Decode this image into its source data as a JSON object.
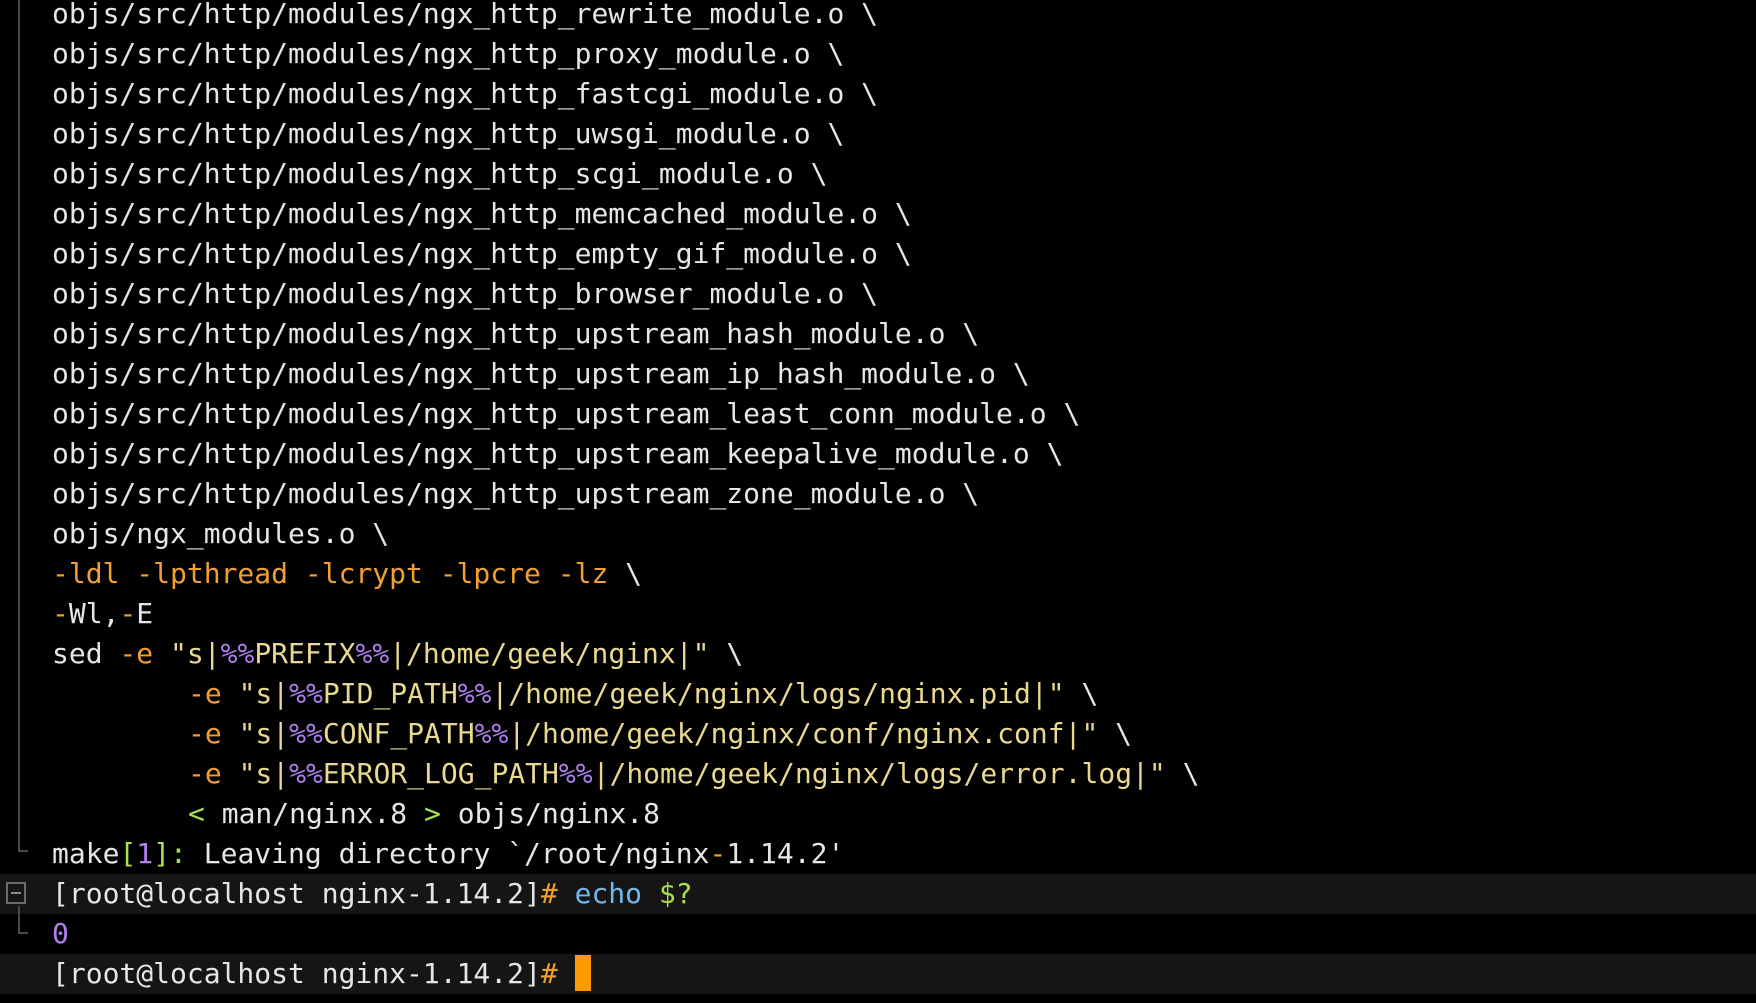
{
  "output_lines": [
    "objs/src/http/modules/ngx_http_rewrite_module.o \\",
    "objs/src/http/modules/ngx_http_proxy_module.o \\",
    "objs/src/http/modules/ngx_http_fastcgi_module.o \\",
    "objs/src/http/modules/ngx_http_uwsgi_module.o \\",
    "objs/src/http/modules/ngx_http_scgi_module.o \\",
    "objs/src/http/modules/ngx_http_memcached_module.o \\",
    "objs/src/http/modules/ngx_http_empty_gif_module.o \\",
    "objs/src/http/modules/ngx_http_browser_module.o \\",
    "objs/src/http/modules/ngx_http_upstream_hash_module.o \\",
    "objs/src/http/modules/ngx_http_upstream_ip_hash_module.o \\",
    "objs/src/http/modules/ngx_http_upstream_least_conn_module.o \\",
    "objs/src/http/modules/ngx_http_upstream_keepalive_module.o \\",
    "objs/src/http/modules/ngx_http_upstream_zone_module.o \\",
    "objs/ngx_modules.o \\"
  ],
  "link_flags": {
    "flags": "-ldl -lpthread -lcrypt -lpcre -lz",
    "cont": " \\",
    "wl_dash": "-",
    "wl": "Wl",
    "wl_comma": ",",
    "wl_e_dash": "-",
    "wl_e": "E"
  },
  "sed": {
    "cmd": "sed",
    "opt": "-e",
    "q1": "\"s|",
    "pct": "%%",
    "prefix": "PREFIX",
    "prefix_tail": "|/home/geek/nginx|\"",
    "pid_path": "PID_PATH",
    "pid_tail": "|/home/geek/nginx/logs/nginx.pid|\"",
    "conf_path": "CONF_PATH",
    "conf_tail": "|/home/geek/nginx/conf/nginx.conf|\"",
    "err_path": "ERROR_LOG_PATH",
    "err_tail": "|/home/geek/nginx/logs/error.log|\"",
    "cont": " \\",
    "lt": "<",
    "man_in": " man/nginx.8 ",
    "gt": ">",
    "man_out": " objs/nginx.8"
  },
  "make_leave": {
    "make": "make",
    "lb": "[",
    "num": "1",
    "rb": "]:",
    "text": " Leaving directory `/root/nginx",
    "dash": "-",
    "version": "1.14.2'"
  },
  "prompt1": {
    "prompt": "[root@localhost nginx-1.14.2]",
    "hash": "#",
    "cmd": " echo",
    "arg": " $?"
  },
  "exit_code": "0",
  "prompt2": {
    "prompt": "[root@localhost nginx-1.14.2]",
    "hash": "#"
  },
  "colors": {
    "background": "#000000",
    "text": "#e6e6e6",
    "orange": "#f0a030",
    "purple": "#b080f0",
    "yellow": "#e8d890",
    "green": "#a8e050",
    "cyan": "#70b8f0",
    "cursor": "#ff9a00"
  },
  "icons": [
    "fold-collapse-icon"
  ]
}
